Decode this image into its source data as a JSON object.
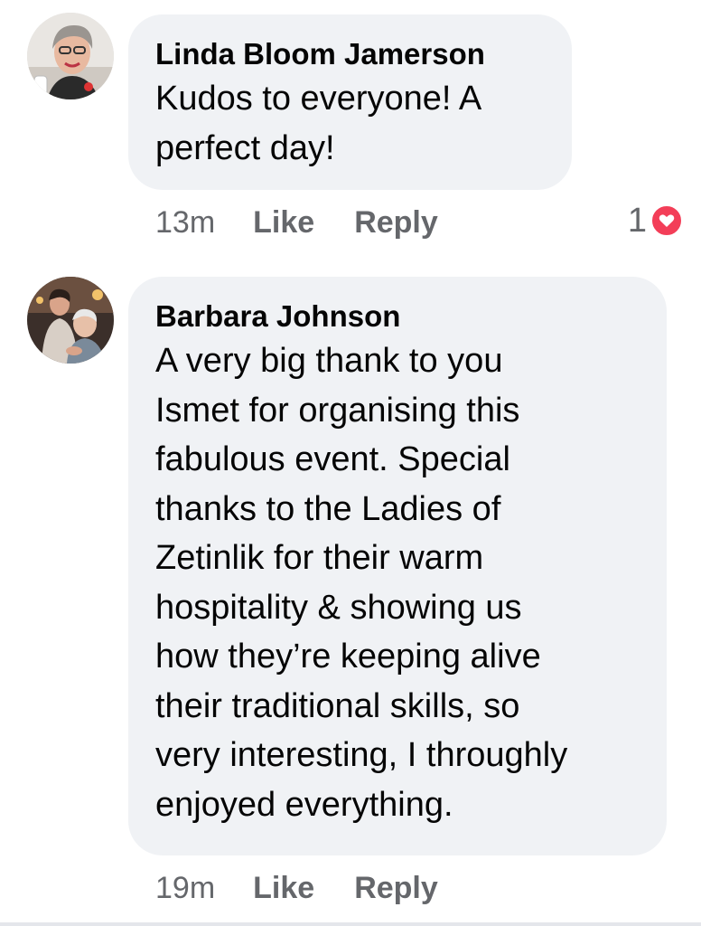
{
  "comments": [
    {
      "author": "Linda Bloom Jamerson",
      "text_lines": [
        "Kudos to everyone! A",
        "perfect day!"
      ],
      "time": "13m",
      "like_label": "Like",
      "reply_label": "Reply",
      "reaction_count": "1",
      "reaction_icon": "heart-icon"
    },
    {
      "author": "Barbara Johnson",
      "text_lines": [
        "A very big thank to you",
        "Ismet for organising this",
        "fabulous event. Special",
        "thanks to the Ladies of",
        "Zetinlik for their warm",
        "hospitality & showing us",
        "how they’re keeping alive",
        "their traditional skills, so",
        "very interesting, I throughly",
        "enjoyed everything."
      ],
      "time": "19m",
      "like_label": "Like",
      "reply_label": "Reply"
    }
  ],
  "colors": {
    "bubble": "#f0f2f5",
    "meta_text": "#65676b",
    "heart": "#f33e58"
  }
}
